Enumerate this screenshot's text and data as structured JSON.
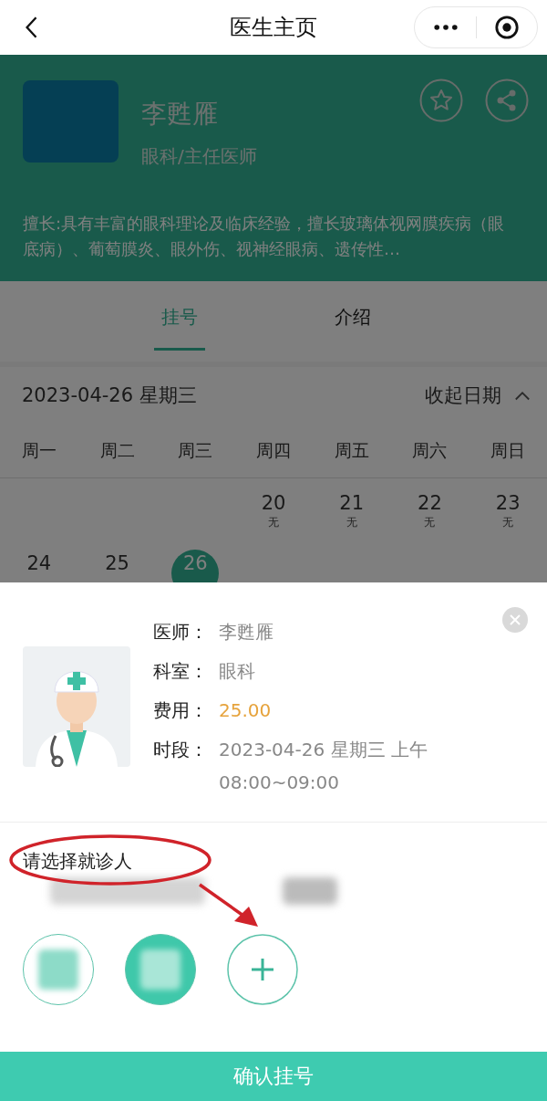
{
  "nav": {
    "title": "医生主页"
  },
  "doctor": {
    "name": "李甦雁",
    "title": "眼科/主任医师",
    "specialty": "擅长:具有丰富的眼科理论及临床经验，擅长玻璃体视网膜疾病（眼底病）、葡萄膜炎、眼外伤、视神经眼病、遗传性…"
  },
  "tabs": [
    {
      "label": "挂号",
      "selected": true
    },
    {
      "label": "介绍",
      "selected": false
    }
  ],
  "calendar": {
    "date": "2023-04-26 星期三",
    "toggle": "收起日期",
    "weekdays": [
      "周一",
      "周二",
      "周三",
      "周四",
      "周五",
      "周六",
      "周日"
    ],
    "weeks": [
      [
        {
          "kind": "blank"
        },
        {
          "kind": "blank"
        },
        {
          "kind": "blank"
        },
        {
          "kind": "day",
          "day": "20",
          "note": "无",
          "selected": false
        },
        {
          "kind": "day",
          "day": "21",
          "note": "无",
          "selected": false
        },
        {
          "kind": "day",
          "day": "22",
          "note": "无",
          "selected": false
        },
        {
          "kind": "day",
          "day": "23",
          "note": "无",
          "selected": false
        }
      ],
      [
        {
          "kind": "day",
          "day": "24",
          "selected": false
        },
        {
          "kind": "day",
          "day": "25",
          "selected": false
        },
        {
          "kind": "day",
          "day": "26",
          "selected": true
        }
      ]
    ]
  },
  "sheet": {
    "fields": [
      {
        "label": "医师：",
        "value": "李甦雁",
        "kind": "plain"
      },
      {
        "label": "科室：",
        "value": "眼科",
        "kind": "plain"
      },
      {
        "label": "费用：",
        "value": "25.00",
        "kind": "price"
      },
      {
        "label": "时段：",
        "value": "2023-04-26 星期三 上午 08:00~09:00",
        "kind": "plain"
      }
    ],
    "prompt": "请选择就诊人",
    "patients": [
      {
        "selected": false
      },
      {
        "selected": true
      }
    ],
    "confirm": "确认挂号"
  },
  "annotations": [
    {
      "kind": "ellipse"
    },
    {
      "kind": "arrow"
    }
  ]
}
